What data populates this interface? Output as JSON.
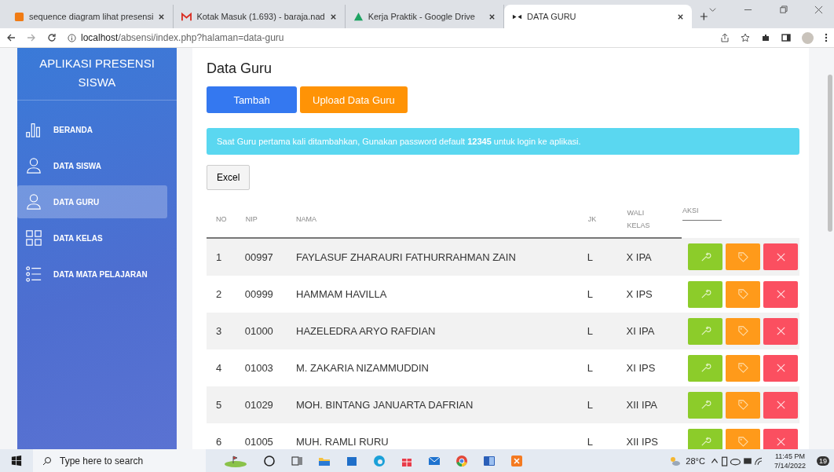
{
  "browser": {
    "tabs": [
      {
        "title": "sequence diagram lihat presensi",
        "selected": false
      },
      {
        "title": "Kotak Masuk (1.693) - baraja.nad",
        "selected": false
      },
      {
        "title": "Kerja Praktik - Google Drive",
        "selected": false
      },
      {
        "title": "DATA GURU",
        "selected": true
      }
    ],
    "address": {
      "host": "localhost",
      "path": "/absensi/index.php?halaman=data-guru"
    }
  },
  "sidebar": {
    "title": "APLIKASI PRESENSI SISWA",
    "items": [
      {
        "label": "BERANDA",
        "selected": false
      },
      {
        "label": "DATA SISWA",
        "selected": false
      },
      {
        "label": "DATA GURU",
        "selected": true
      },
      {
        "label": "DATA KELAS",
        "selected": false
      },
      {
        "label": "DATA MATA PELAJARAN",
        "selected": false
      }
    ]
  },
  "page": {
    "title": "Data Guru",
    "buttons": [
      {
        "label": "Tambah",
        "kind": "primary"
      },
      {
        "label": "Upload Data Guru",
        "kind": "warning"
      }
    ],
    "alert": "Saat Guru pertama kali ditambahkan, Gunakan password default **12345** untuk login ke aplikasi.",
    "export_button": "Excel",
    "table": {
      "columns": [
        "NO",
        "NIP",
        "NAMA",
        "JK",
        "WALI KELAS",
        "AKSI"
      ],
      "actions": [
        {
          "kind": "edit"
        },
        {
          "kind": "tag"
        },
        {
          "kind": "delete"
        }
      ],
      "rows": [
        [
          "1",
          "00997",
          "FAYLASUF ZHARAURI FATHURRAHMAN ZAIN",
          "L",
          "X IPA"
        ],
        [
          "2",
          "00999",
          "HAMMAM HAVILLA",
          "L",
          "X IPS"
        ],
        [
          "3",
          "01000",
          "HAZELEDRA ARYO RAFDIAN",
          "L",
          "XI IPA"
        ],
        [
          "4",
          "01003",
          "M. ZAKARIA NIZAMMUDDIN",
          "L",
          "XI IPS"
        ],
        [
          "5",
          "01029",
          "MOH. BINTANG JANUARTA DAFRIAN",
          "L",
          "XII IPA"
        ],
        [
          "6",
          "01005",
          "MUH. RAMLI RURU",
          "L",
          "XII IPS"
        ]
      ]
    }
  },
  "taskbar": {
    "search_placeholder": "Type here to search",
    "weather": "28°C",
    "time": "11:45 PM",
    "date": "7/14/2022",
    "notifications": "19"
  }
}
